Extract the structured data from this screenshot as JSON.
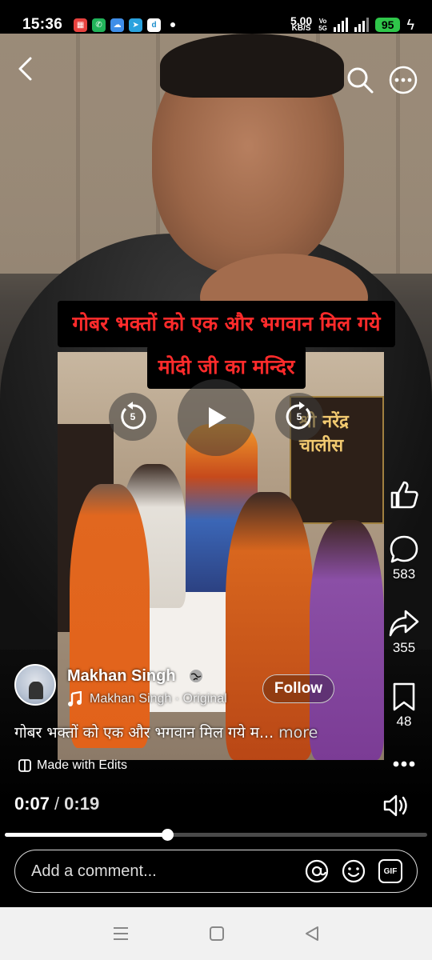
{
  "status_bar": {
    "time": "15:36",
    "net_speed": "5.00",
    "net_unit": "KB/S",
    "battery": "95",
    "volte_top": "Vo",
    "volte_bottom": "5G",
    "network": "5G",
    "colors": {
      "battery": "#2fc64a"
    }
  },
  "top_bar": {
    "back_icon": "chevron-left-icon",
    "search_icon": "search-icon",
    "more_icon": "more-horizontal-icon"
  },
  "video": {
    "caption_line1": "गोबर भक्तों को एक और भगवान मिल गये",
    "caption_line2": "मोदी जी का मन्दिर",
    "banner_text1": "श्री नरेंद्र",
    "banner_text2": "चालीस",
    "rewind_seconds": "5",
    "forward_seconds": "5",
    "caption_color": "#ff2b2b"
  },
  "actions": {
    "like_icon": "thumbs-up-icon",
    "comment_count": "583",
    "share_count": "355",
    "save_count": "48",
    "more_icon": "more-horizontal-icon"
  },
  "post": {
    "author": "Makhan Singh",
    "audio": "Makhan Singh · Original",
    "follow_label": "Follow",
    "description": "गोबर भक्तों को एक और भगवान मिल गये म...",
    "more_label": "more",
    "made_with": "Made with Edits"
  },
  "player": {
    "current_time": "0:07",
    "separator": "/",
    "duration": "0:19",
    "progress": 0.385
  },
  "comment_box": {
    "placeholder": "Add a comment...",
    "gif_label": "GIF"
  }
}
